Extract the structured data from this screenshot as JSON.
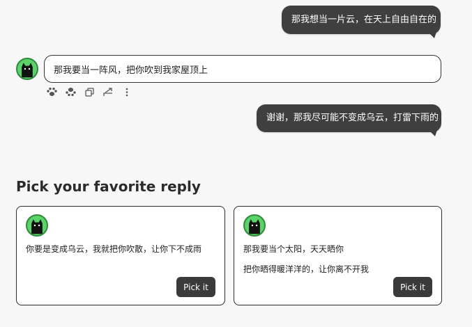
{
  "conversation": {
    "messages": [
      {
        "role": "user",
        "text": "那我想当一片云，在天上自由自在的"
      },
      {
        "role": "bot",
        "text": "那我要当一阵风，把你吹到我家屋顶上"
      },
      {
        "role": "user",
        "text": "谢谢，那我尽可能不变成乌云，打雷下雨的"
      }
    ],
    "message_actions": [
      "paw-like-icon",
      "paw-dislike-icon",
      "copy-icon",
      "share-icon",
      "more-icon"
    ]
  },
  "pick_section": {
    "title": "Pick your favorite reply",
    "candidates": [
      {
        "lines": [
          "你要是变成乌云，我就把你吹散，让你下不成雨"
        ],
        "button": "Pick it"
      },
      {
        "lines": [
          "那我要当个太阳，天天晒你",
          "把你晒得暖洋洋的，让你离不开我"
        ],
        "button": "Pick it"
      }
    ]
  },
  "colors": {
    "user_bubble": "#3f3f3f",
    "avatar_bg": "#5bd26a",
    "button_bg": "#3a3a3a",
    "page_bg": "#f7f7f7"
  }
}
